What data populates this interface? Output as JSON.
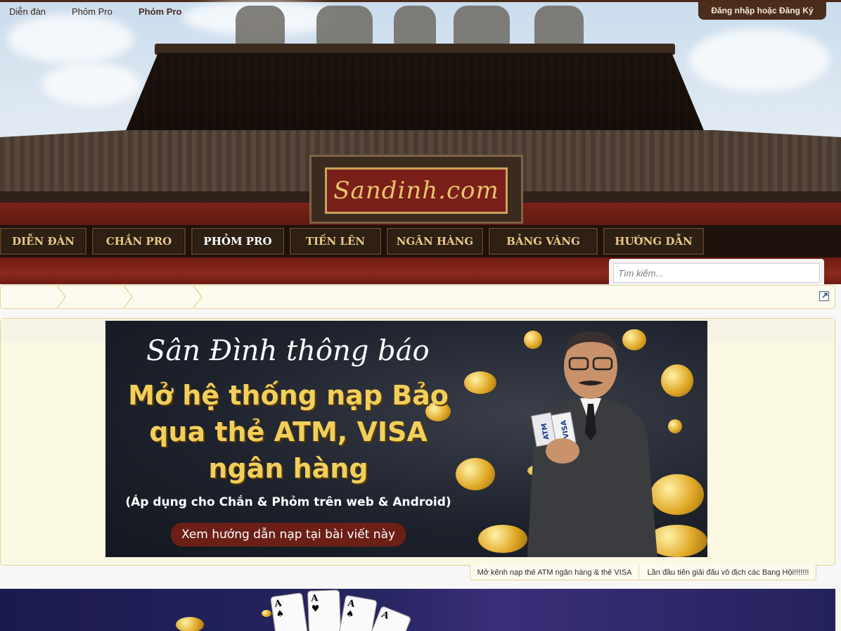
{
  "header": {
    "logo_text": "Sandinh.com",
    "login_label": "Đăng nhập hoặc Đăng Ký"
  },
  "nav": {
    "items": [
      {
        "label": "DIỄN ĐÀN"
      },
      {
        "label": "CHẮN PRO"
      },
      {
        "label": "PHỎM PRO",
        "active": true
      },
      {
        "label": "TIẾN LÊN"
      },
      {
        "label": "NGÂN HÀNG"
      },
      {
        "label": "BẢNG VÀNG"
      },
      {
        "label": "HƯỚNG DẪN"
      }
    ]
  },
  "search": {
    "placeholder": "Tìm kiếm..."
  },
  "breadcrumb": {
    "items": [
      "Diễn đàn",
      "Phỏm Pro",
      "Phỏm Pro"
    ]
  },
  "banner": {
    "title": "Sân Đình thông báo",
    "headline_1": "Mở hệ thống nạp Bảo",
    "headline_2": "qua thẻ ATM, VISA",
    "headline_3": "ngân hàng",
    "note": "(Áp dụng cho Chắn & Phỏm trên web & Android)",
    "cta": "Xem hướng dẫn nạp tại bài viết này",
    "card_labels": [
      "ATM",
      "VISA"
    ]
  },
  "ticker": {
    "items": [
      "Mở kênh nạp thẻ ATM ngân hàng & thẻ VISA",
      "Lần đầu tiên giải đấu vô địch các Bang Hội!!!!!!!"
    ]
  },
  "colors": {
    "nav_text": "#e8c98a",
    "accent_red": "#7a1f19",
    "panel_bg": "#fbf8e3",
    "border_gold": "#e7d48e"
  }
}
